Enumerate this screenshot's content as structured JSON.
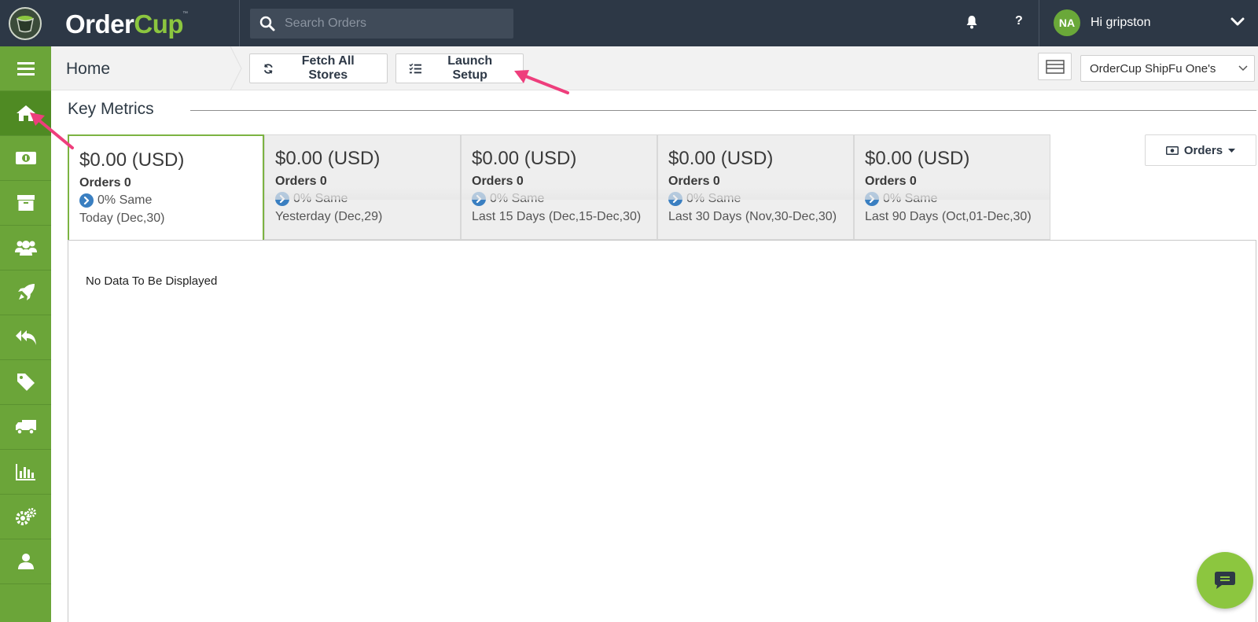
{
  "brand": {
    "name_part1": "Order",
    "name_part2": "Cup",
    "tm": "™"
  },
  "search": {
    "placeholder": "Search Orders"
  },
  "user": {
    "initials": "NA",
    "greeting": "Hi gripston"
  },
  "header": {
    "title": "Home",
    "fetch_label": "Fetch All Stores",
    "setup_label": "Launch Setup",
    "store_selected": "OrderCup ShipFu One's"
  },
  "sidebar": {
    "items": [
      {
        "icon": "menu-icon"
      },
      {
        "icon": "home-icon",
        "active": true
      },
      {
        "icon": "money-icon"
      },
      {
        "icon": "archive-icon"
      },
      {
        "icon": "users-icon"
      },
      {
        "icon": "rocket-icon"
      },
      {
        "icon": "reply-all-icon"
      },
      {
        "icon": "tag-icon"
      },
      {
        "icon": "truck-icon"
      },
      {
        "icon": "bar-chart-icon"
      },
      {
        "icon": "gears-icon"
      },
      {
        "icon": "user-icon"
      }
    ]
  },
  "metrics": {
    "title": "Key Metrics",
    "dropdown_label": "Orders",
    "tiles": [
      {
        "amount": "$0.00 (USD)",
        "orders": "Orders 0",
        "change": "0% Same",
        "period": "Today (Dec,30)"
      },
      {
        "amount": "$0.00 (USD)",
        "orders": "Orders 0",
        "change": "0% Same",
        "period": "Yesterday (Dec,29)"
      },
      {
        "amount": "$0.00 (USD)",
        "orders": "Orders 0",
        "change": "0% Same",
        "period": "Last 15 Days (Dec,15-Dec,30)"
      },
      {
        "amount": "$0.00 (USD)",
        "orders": "Orders 0",
        "change": "0% Same",
        "period": "Last 30 Days (Nov,30-Dec,30)"
      },
      {
        "amount": "$0.00 (USD)",
        "orders": "Orders 0",
        "change": "0% Same",
        "period": "Last 90 Days (Oct,01-Dec,30)"
      }
    ],
    "empty_message": "No Data To Be Displayed"
  },
  "colors": {
    "topbar": "#2d3846",
    "sidebar": "#6ba539",
    "accent": "#8cc63f",
    "annotation": "#ee3e7c"
  }
}
